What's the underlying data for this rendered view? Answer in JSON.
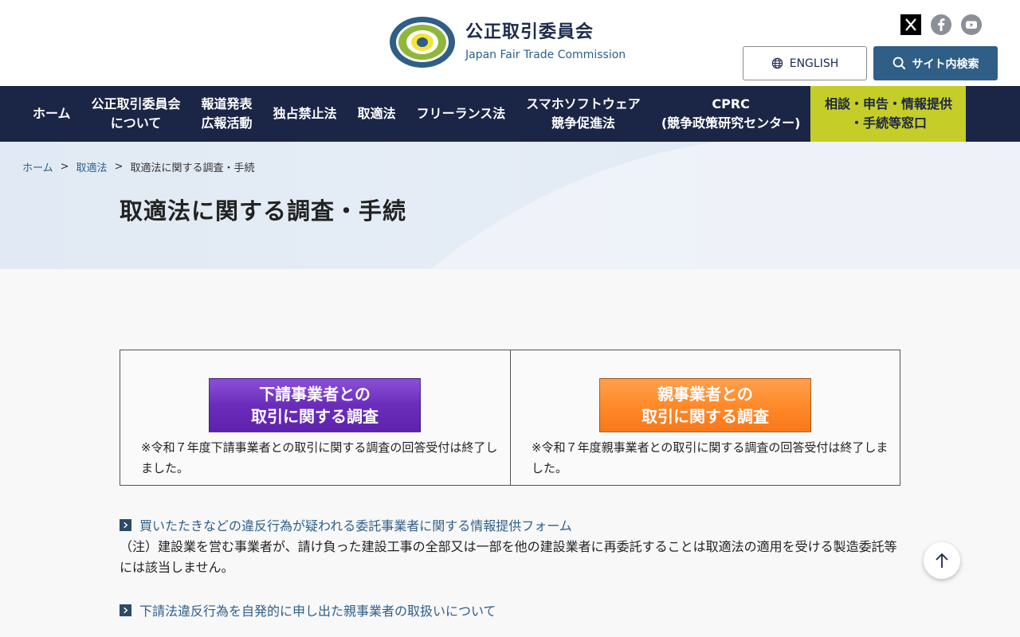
{
  "header": {
    "logo_ja": "公正取引委員会",
    "logo_en": "Japan Fair Trade Commission",
    "logo_ring_text": "JAPAN FAIR TRADE COMMISSION",
    "english_label": "ENGLISH",
    "search_label": "サイト内検索",
    "social": [
      "x-icon",
      "facebook-icon",
      "youtube-icon"
    ]
  },
  "nav": {
    "items": [
      {
        "label": "ホーム"
      },
      {
        "label": "公正取引委員会\nについて"
      },
      {
        "label": "報道発表\n広報活動"
      },
      {
        "label": "独占禁止法"
      },
      {
        "label": "取適法"
      },
      {
        "label": "フリーランス法"
      },
      {
        "label": "スマホソフトウェア\n競争促進法"
      },
      {
        "label": "CPRC\n(競争政策研究センター)"
      }
    ],
    "cta_label": "相談・申告・情報提供\n・手続等窓口"
  },
  "breadcrumb": {
    "home": "ホーム",
    "parent": "取適法",
    "current": "取適法に関する調査・手続",
    "separator": ">"
  },
  "page_title": "取適法に関する調査・手続",
  "survey": {
    "left": {
      "banner": "下請事業者との\n取引に関する調査",
      "note": "※令和７年度下請事業者との取引に関する調査の回答受付は終了しました。"
    },
    "right": {
      "banner": "親事業者との\n取引に関する調査",
      "note": "※令和７年度親事業者との取引に関する調査の回答受付は終了しました。"
    }
  },
  "links": {
    "info_form": "買いたたきなどの違反行為が疑われる委託事業者に関する情報提供フォーム",
    "note": "（注）建設業を営む事業者が、請け負った建設工事の全部又は一部を他の建設業者に再委託することは取適法の適用を受ける製造委託等には該当しません。",
    "voluntary": "下請法違反行為を自発的に申し出た親事業者の取扱いについて"
  },
  "colors": {
    "nav_bg": "#1b2646",
    "cta_bg": "#c5cd29",
    "accent_blue": "#2f5e86",
    "banner_purple": "#6a2dbb",
    "banner_orange": "#ff8a2a"
  }
}
